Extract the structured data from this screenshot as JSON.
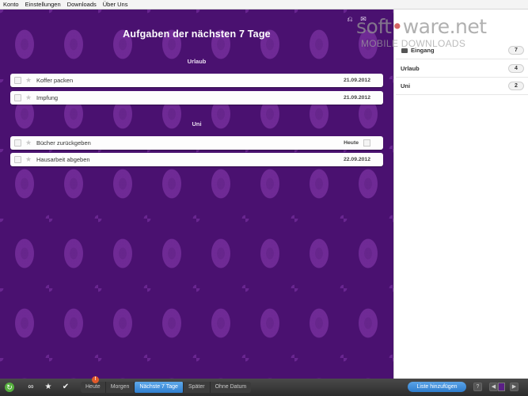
{
  "menu": [
    "Konto",
    "Einstellungen",
    "Downloads",
    "Über Uns"
  ],
  "main": {
    "title": "Aufgaben der nächsten 7 Tage",
    "sections": [
      {
        "name": "Urlaub",
        "tasks": [
          {
            "title": "Koffer packen",
            "date": "21.09.2012"
          },
          {
            "title": "Impfung",
            "date": "21.09.2012"
          }
        ]
      },
      {
        "name": "Uni",
        "tasks": [
          {
            "title": "Bücher zurückgeben",
            "date": "Heute"
          },
          {
            "title": "Hausarbeit abgeben",
            "date": "22.09.2012"
          }
        ]
      }
    ]
  },
  "brand": {
    "logo_left": "soft",
    "logo_dot": "•",
    "logo_right": "ware.net",
    "subtitle": "MOBILE DOWNLOADS"
  },
  "sidebar": {
    "lists": [
      {
        "label": "Eingang",
        "count": "7"
      },
      {
        "label": "Urlaub",
        "count": "4"
      },
      {
        "label": "Uni",
        "count": "2"
      }
    ]
  },
  "toolbar": {
    "tabs": [
      "Heute",
      "Morgen",
      "Nächste 7 Tage",
      "Später",
      "Ohne Datum"
    ],
    "active_tab": "Nächste 7 Tage",
    "heute_badge": "!",
    "add_list": "Liste hinzufügen",
    "help": "?"
  },
  "colors": {
    "background": "#4a1170",
    "accent": "#2f7fd0",
    "sync": "#56b03e"
  }
}
